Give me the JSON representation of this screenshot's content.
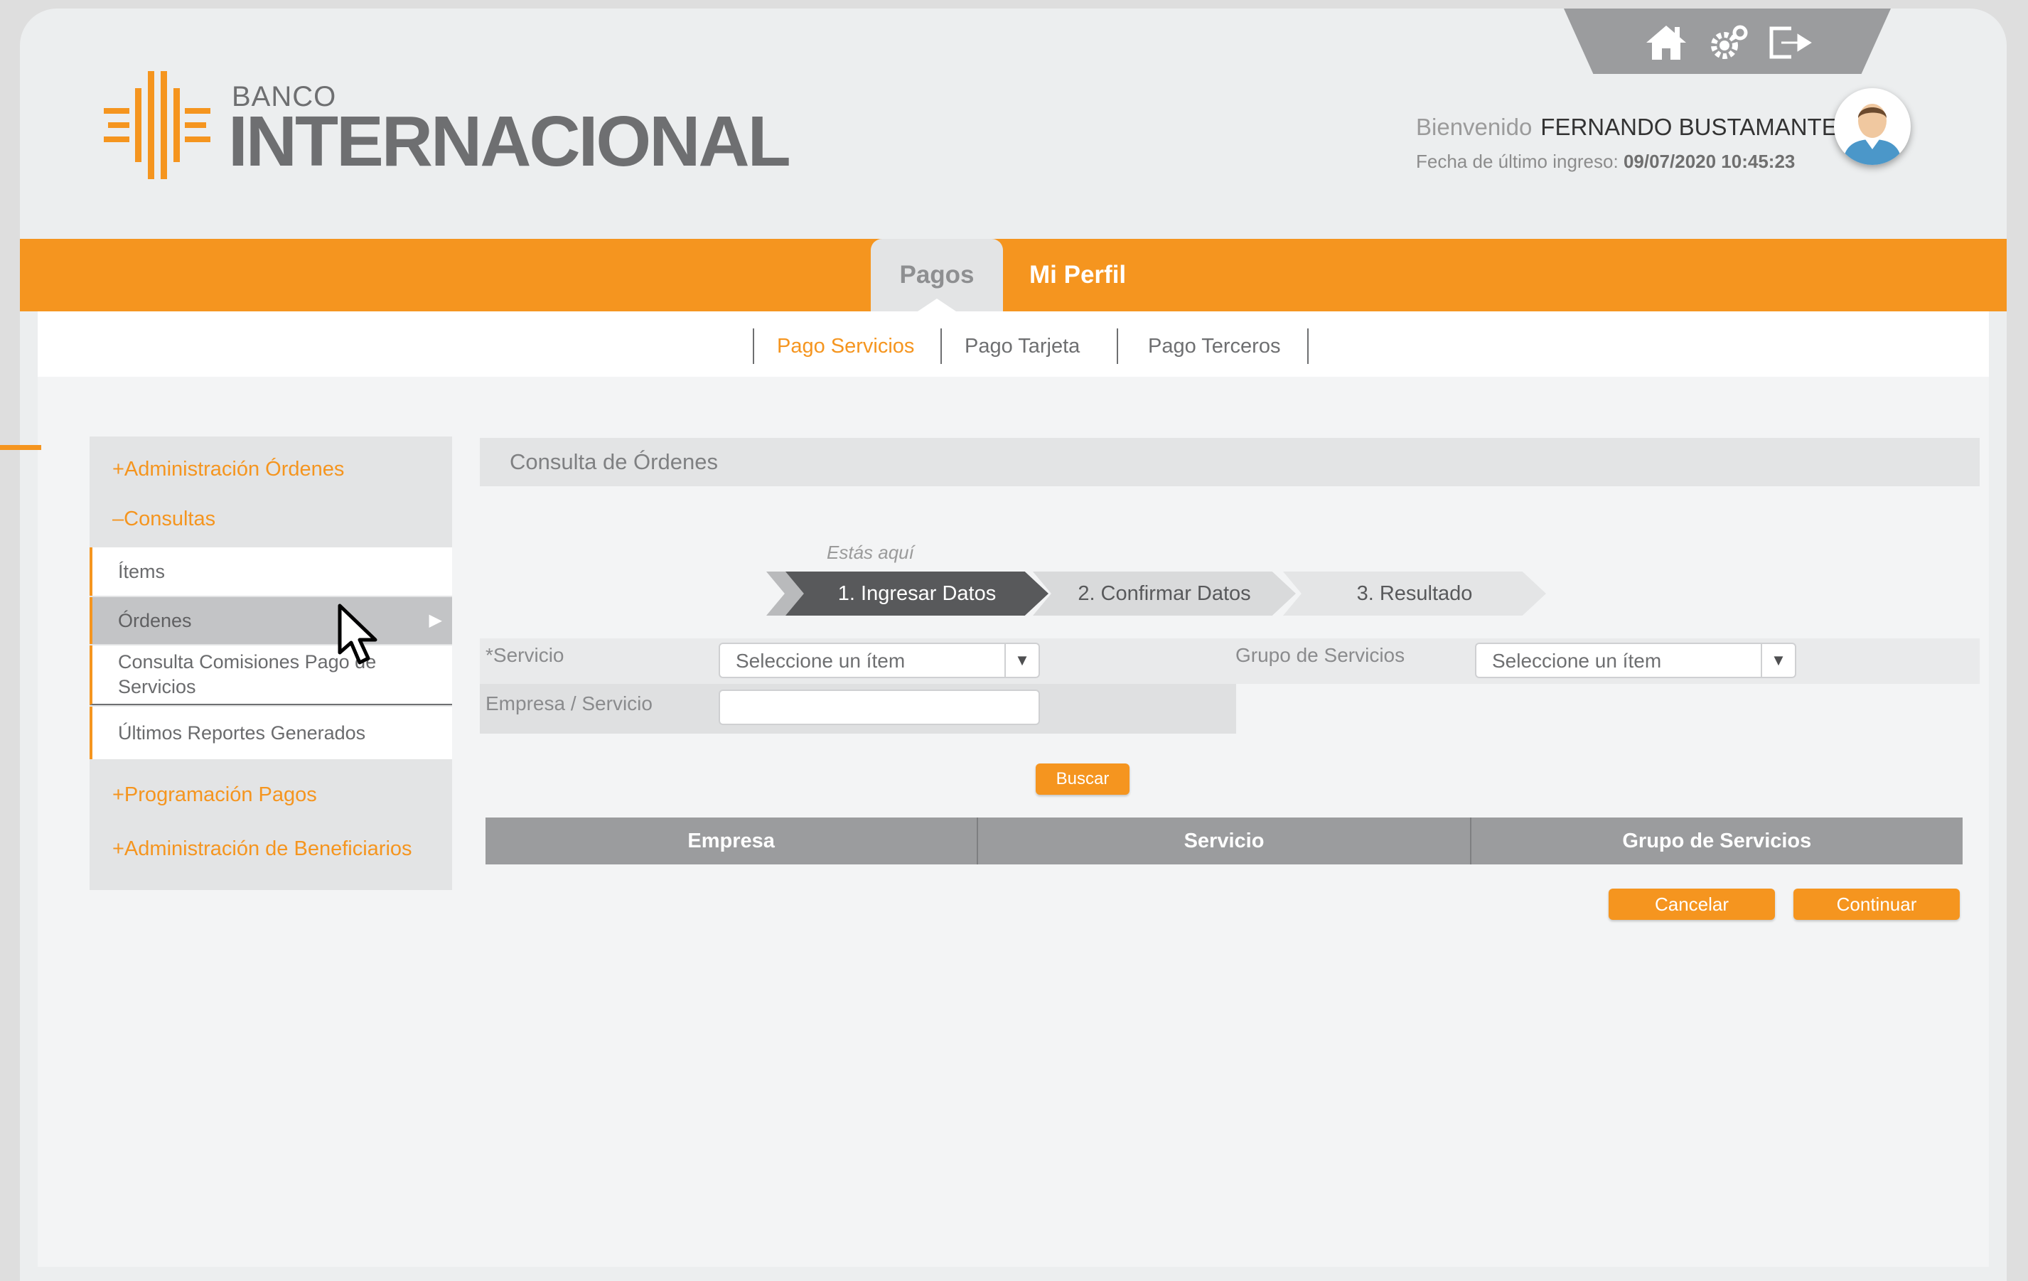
{
  "logo": {
    "small": "BANCO",
    "main": "INTERNACIONAL"
  },
  "header": {
    "icons": [
      "home-icon",
      "settings-icon",
      "logout-icon"
    ],
    "welcome_label": "Bienvenido",
    "user_name": "FERNANDO BUSTAMANTE",
    "last_login_label": "Fecha de último ingreso:",
    "last_login_value": "09/07/2020 10:45:23"
  },
  "nav": {
    "tabs": [
      {
        "label": "Pagos",
        "active": true
      },
      {
        "label": "Mi Perfil",
        "active": false
      }
    ],
    "subtabs": [
      {
        "label": "Pago Servicios",
        "active": true
      },
      {
        "label": "Pago Tarjeta",
        "active": false
      },
      {
        "label": "Pago Terceros",
        "active": false
      }
    ]
  },
  "sidebar": {
    "admin_ordenes": "+Administración Órdenes",
    "consultas": "–Consultas",
    "items": [
      "Ítems",
      "Órdenes",
      "Consulta Comisiones Pago de Servicios",
      "Últimos Reportes Generados"
    ],
    "active_item": "Órdenes",
    "programacion": "+Programación Pagos",
    "beneficiarios": "+Administración de Beneficiarios"
  },
  "main": {
    "title": "Consulta de Órdenes",
    "breadcrumb_hint": "Estás aquí",
    "steps": [
      "1. Ingresar Datos",
      "2. Confirmar Datos",
      "3. Resultado"
    ],
    "active_step": 0,
    "form": {
      "servicio_label": "*Servicio",
      "servicio_value": "Seleccione un ítem",
      "grupo_label": "Grupo de Servicios",
      "grupo_value": "Seleccione un ítem",
      "empresa_label": "Empresa / Servicio",
      "empresa_value": ""
    },
    "search_button": "Buscar",
    "table_headers": [
      "Empresa",
      "Servicio",
      "Grupo de Servicios"
    ],
    "cancel_button": "Cancelar",
    "continue_button": "Continuar"
  },
  "colors": {
    "accent": "#f5951f",
    "header_gray": "#9b9c9e",
    "panel": "#e3e4e5",
    "step_active": "#58595b"
  }
}
